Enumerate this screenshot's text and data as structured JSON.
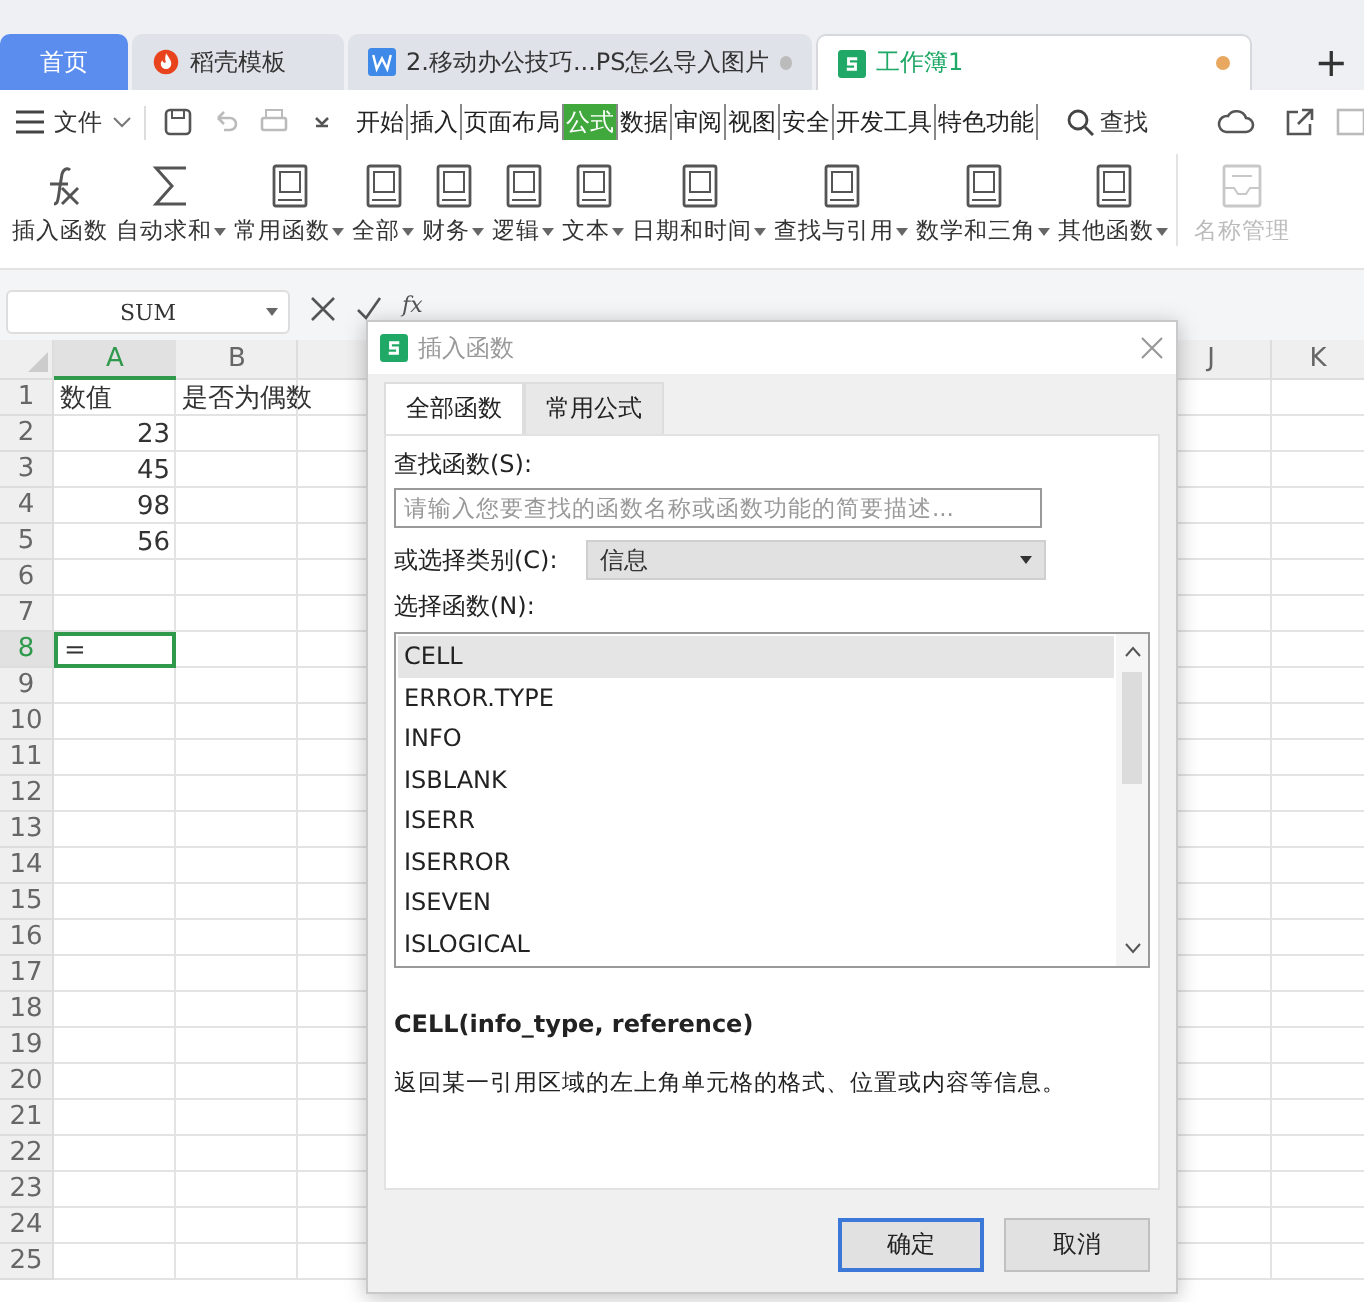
{
  "title_tabs": [
    {
      "label": "首页",
      "kind": "home",
      "selected": false
    },
    {
      "label": "稻壳模板",
      "kind": "docer",
      "selected": false
    },
    {
      "label": "2.移动办公技巧...PS怎么导入图片",
      "kind": "word",
      "selected": false
    },
    {
      "label": "工作簿1",
      "kind": "sheet",
      "selected": true
    }
  ],
  "new_tab": "+",
  "menu": {
    "file": "文件",
    "tabs": [
      {
        "label": "开始",
        "selected": false
      },
      {
        "label": "插入",
        "selected": false
      },
      {
        "label": "页面布局",
        "selected": false
      },
      {
        "label": "公式",
        "selected": true
      },
      {
        "label": "数据",
        "selected": false
      },
      {
        "label": "审阅",
        "selected": false
      },
      {
        "label": "视图",
        "selected": false
      },
      {
        "label": "安全",
        "selected": false
      },
      {
        "label": "开发工具",
        "selected": false
      },
      {
        "label": "特色功能",
        "selected": false
      }
    ],
    "search": "查找"
  },
  "ribbon": [
    {
      "label": "插入函数",
      "kind": "fx",
      "dropdown": false,
      "disabled": false
    },
    {
      "label": "自动求和",
      "kind": "sum",
      "dropdown": true,
      "disabled": false
    },
    {
      "label": "常用函数",
      "kind": "book",
      "dropdown": true,
      "disabled": false
    },
    {
      "label": "全部",
      "kind": "book",
      "dropdown": true,
      "disabled": false
    },
    {
      "label": "财务",
      "kind": "book",
      "dropdown": true,
      "disabled": false
    },
    {
      "label": "逻辑",
      "kind": "book",
      "dropdown": true,
      "disabled": false
    },
    {
      "label": "文本",
      "kind": "book",
      "dropdown": true,
      "disabled": false
    },
    {
      "label": "日期和时间",
      "kind": "book",
      "dropdown": true,
      "disabled": false
    },
    {
      "label": "查找与引用",
      "kind": "book",
      "dropdown": true,
      "disabled": false
    },
    {
      "label": "数学和三角",
      "kind": "book",
      "dropdown": true,
      "disabled": false
    },
    {
      "label": "其他函数",
      "kind": "book",
      "dropdown": true,
      "disabled": false
    },
    {
      "label": "名称管理",
      "kind": "tray",
      "dropdown": false,
      "disabled": true
    }
  ],
  "formula_bar": {
    "name_box": "SUM",
    "fx": "fx"
  },
  "sheet": {
    "columns": [
      {
        "label": "A",
        "selected": true
      },
      {
        "label": "B",
        "selected": false
      },
      {
        "label": "J",
        "selected": false
      },
      {
        "label": "K",
        "selected": false
      }
    ],
    "rows": [
      {
        "header": "1",
        "selected": false,
        "cells": [
          {
            "text": "数值",
            "kind": "text",
            "selected": false
          },
          {
            "text": "是否为偶数",
            "kind": "text",
            "selected": false
          }
        ]
      },
      {
        "header": "2",
        "selected": false,
        "cells": [
          {
            "text": "23",
            "kind": "number",
            "selected": false
          }
        ]
      },
      {
        "header": "3",
        "selected": false,
        "cells": [
          {
            "text": "45",
            "kind": "number",
            "selected": false
          }
        ]
      },
      {
        "header": "4",
        "selected": false,
        "cells": [
          {
            "text": "98",
            "kind": "number",
            "selected": false
          }
        ]
      },
      {
        "header": "5",
        "selected": false,
        "cells": [
          {
            "text": "56",
            "kind": "number",
            "selected": false
          }
        ]
      },
      {
        "header": "6",
        "selected": false
      },
      {
        "header": "7",
        "selected": false
      },
      {
        "header": "8",
        "selected": true,
        "cells": [
          {
            "text": "=",
            "kind": "text",
            "selected": true
          }
        ]
      },
      {
        "header": "9",
        "selected": false
      },
      {
        "header": "10",
        "selected": false
      },
      {
        "header": "11",
        "selected": false
      },
      {
        "header": "12",
        "selected": false
      },
      {
        "header": "13",
        "selected": false
      },
      {
        "header": "14",
        "selected": false
      },
      {
        "header": "15",
        "selected": false
      },
      {
        "header": "16",
        "selected": false
      },
      {
        "header": "17",
        "selected": false
      },
      {
        "header": "18",
        "selected": false
      },
      {
        "header": "19",
        "selected": false
      },
      {
        "header": "20",
        "selected": false
      },
      {
        "header": "21",
        "selected": false
      },
      {
        "header": "22",
        "selected": false
      },
      {
        "header": "23",
        "selected": false
      },
      {
        "header": "24",
        "selected": false
      },
      {
        "header": "25",
        "selected": false
      }
    ]
  },
  "dialog": {
    "title": "插入函数",
    "tabs": [
      {
        "label": "全部函数",
        "selected": true
      },
      {
        "label": "常用公式",
        "selected": false
      }
    ],
    "search_label": "查找函数(S):",
    "search": {
      "placeholder": "请输入您要查找的函数名称或函数功能的简要描述..."
    },
    "category_label": "或选择类别(C):",
    "category": "信息",
    "list_label": "选择函数(N):",
    "functions": [
      {
        "name": "CELL",
        "selected": true
      },
      {
        "name": "ERROR.TYPE",
        "selected": false
      },
      {
        "name": "INFO",
        "selected": false
      },
      {
        "name": "ISBLANK",
        "selected": false
      },
      {
        "name": "ISERR",
        "selected": false
      },
      {
        "name": "ISERROR",
        "selected": false
      },
      {
        "name": "ISEVEN",
        "selected": false
      },
      {
        "name": "ISLOGICAL",
        "selected": false
      }
    ],
    "signature": "CELL(info_type, reference)",
    "description": "返回某一引用区域的左上角单元格的格式、位置或内容等信息。",
    "buttons": [
      {
        "label": "确定",
        "kind": "primary"
      },
      {
        "label": "取消",
        "kind": "secondary"
      }
    ]
  }
}
